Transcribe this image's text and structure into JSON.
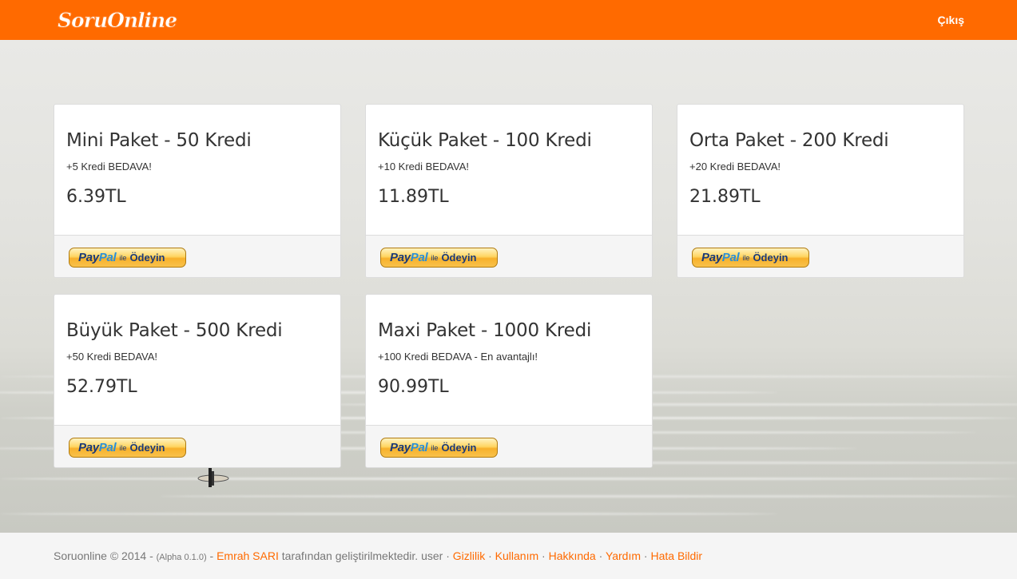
{
  "header": {
    "brand": "SoruOnline",
    "logout_label": "Çıkış"
  },
  "packages": [
    {
      "title": "Mini Paket - 50 Kredi",
      "bonus": "+5 Kredi BEDAVA!",
      "price": "6.39TL"
    },
    {
      "title": "Küçük Paket - 100 Kredi",
      "bonus": "+10 Kredi BEDAVA!",
      "price": "11.89TL"
    },
    {
      "title": "Orta Paket - 200 Kredi",
      "bonus": "+20 Kredi BEDAVA!",
      "price": "21.89TL"
    },
    {
      "title": "Büyük Paket - 500 Kredi",
      "bonus": "+50 Kredi BEDAVA!",
      "price": "52.79TL"
    },
    {
      "title": "Maxi Paket - 1000 Kredi",
      "bonus": "+100 Kredi BEDAVA - En avantajlı!",
      "price": "90.99TL"
    }
  ],
  "paypal_button": {
    "pay": "Pay",
    "pal": "Pal",
    "ile": "ile",
    "odeyin": "Ödeyin"
  },
  "footer": {
    "copyright": "Soruonline © 2014 -",
    "version": "(Alpha 0.1.0)",
    "dash": "-",
    "author_link": "Emrah SARI",
    "developed_text": "tarafından geliştirilmektedir. user ·",
    "links": [
      "Gizlilik",
      "Kullanım",
      "Hakkında",
      "Yardım",
      "Hata Bildir"
    ],
    "separator": "·"
  },
  "colors": {
    "accent": "#ff6a00",
    "footer_bg": "#f5f5f5",
    "card_footer_bg": "#f5f5f5"
  }
}
